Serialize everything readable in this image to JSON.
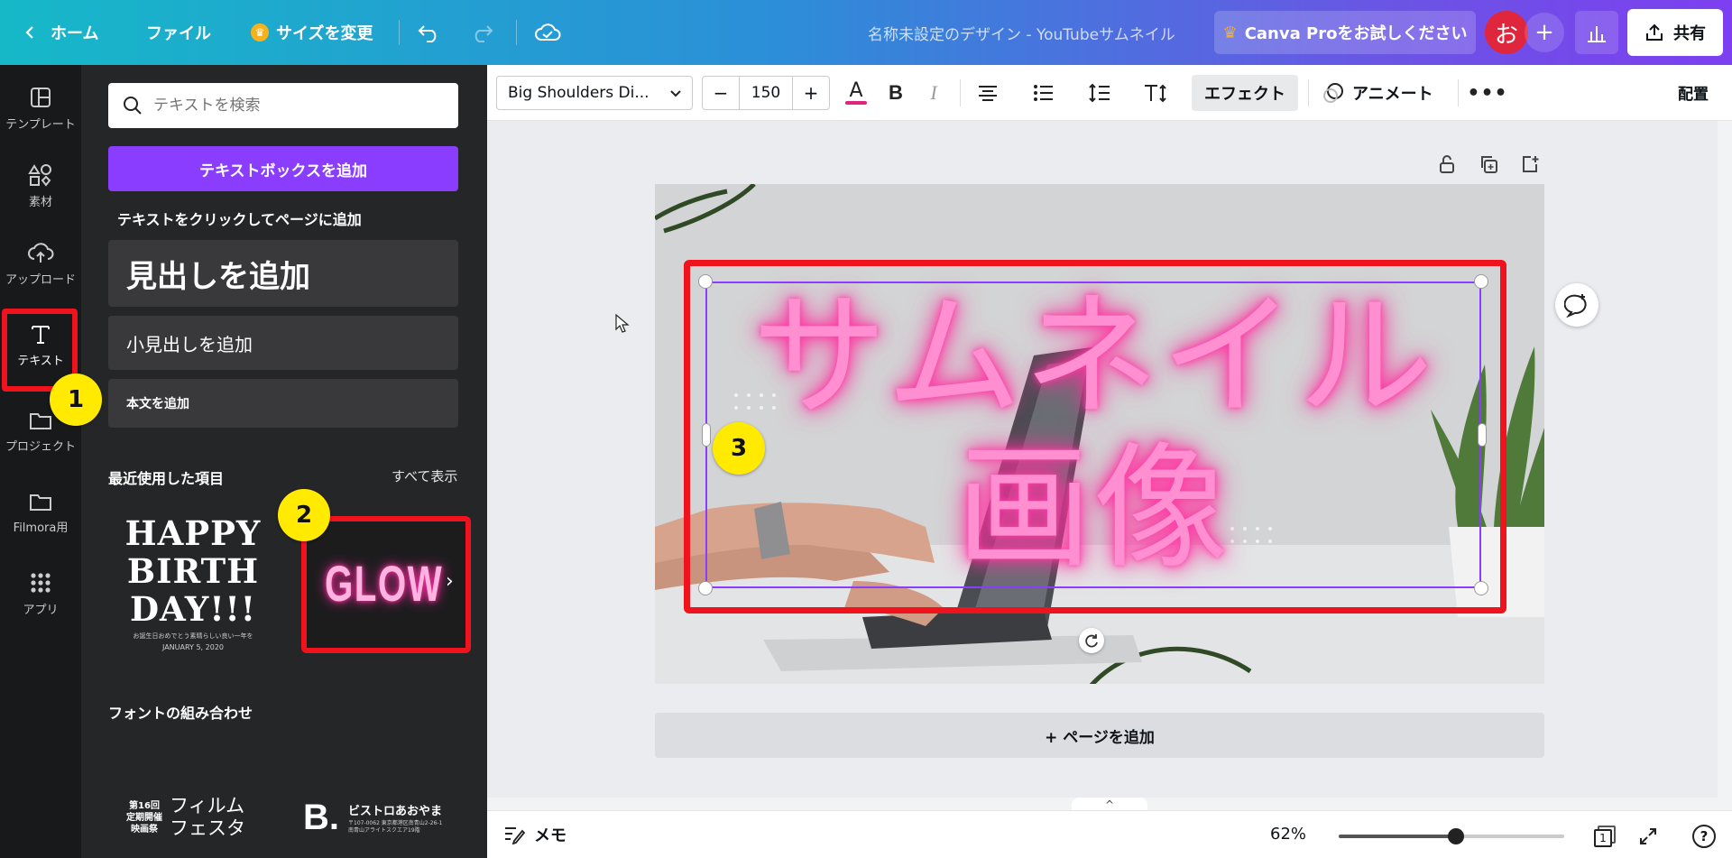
{
  "topbar": {
    "home": "ホーム",
    "file": "ファイル",
    "resize": "サイズを変更",
    "title": "名称未設定のデザイン - YouTubeサムネイル",
    "pro": "Canva Proをお試しください",
    "avatar_initial": "お",
    "share": "共有"
  },
  "rail": {
    "items": [
      {
        "label": "テンプレート",
        "icon": "template-icon"
      },
      {
        "label": "素材",
        "icon": "elements-icon"
      },
      {
        "label": "アップロード",
        "icon": "upload-icon"
      },
      {
        "label": "テキスト",
        "icon": "text-icon"
      },
      {
        "label": "プロジェクト",
        "icon": "folder-icon"
      },
      {
        "label": "Filmora用",
        "icon": "folder-icon"
      },
      {
        "label": "アプリ",
        "icon": "apps-icon"
      }
    ]
  },
  "panel": {
    "search_placeholder": "テキストを検索",
    "add_textbox": "テキストボックスを追加",
    "caption": "テキストをクリックしてページに追加",
    "heading": "見出しを追加",
    "subheading": "小見出しを追加",
    "body": "本文を追加",
    "recent_title": "最近使用した項目",
    "see_all": "すべて表示",
    "happy_birthday": {
      "line1": "HAPPY",
      "line2": "BIRTH",
      "line3": "DAY!!!",
      "small": "お誕生日おめでとう素晴らしい良い一年を",
      "date": "JANUARY 5, 2020"
    },
    "glow_template": "GLOW",
    "font_combos_title": "フォントの組み合わせ",
    "combo1": {
      "left": "第16回\n定期開催\n映画祭",
      "right_line1": "フィルム",
      "right_line2": "フェスタ"
    },
    "combo2": {
      "mark": "B.",
      "name": "ビストロあおやま",
      "address": "〒107-0062 東京都港区南青山2-26-1\n南青山アライトスクエア19階"
    }
  },
  "badges": {
    "one": "1",
    "two": "2",
    "three": "3"
  },
  "editor": {
    "font": "Big Shoulders Di...",
    "font_size": "150",
    "minus": "−",
    "plus": "+",
    "effects": "エフェクト",
    "animate": "アニメート",
    "arrange": "配置",
    "text_color": "#e0267c"
  },
  "canvas": {
    "line1": "サムネイル",
    "line2": "画像",
    "add_page": "+ ページを追加"
  },
  "bottombar": {
    "notes": "メモ",
    "zoom": "62%",
    "zoom_level": 0.62,
    "page_count": "1",
    "help": "?"
  },
  "colors": {
    "accent": "#8b3dff",
    "highlight_red": "#f0121d",
    "badge_yellow": "#ffea00",
    "neon_pink": "#ff8fd0"
  }
}
